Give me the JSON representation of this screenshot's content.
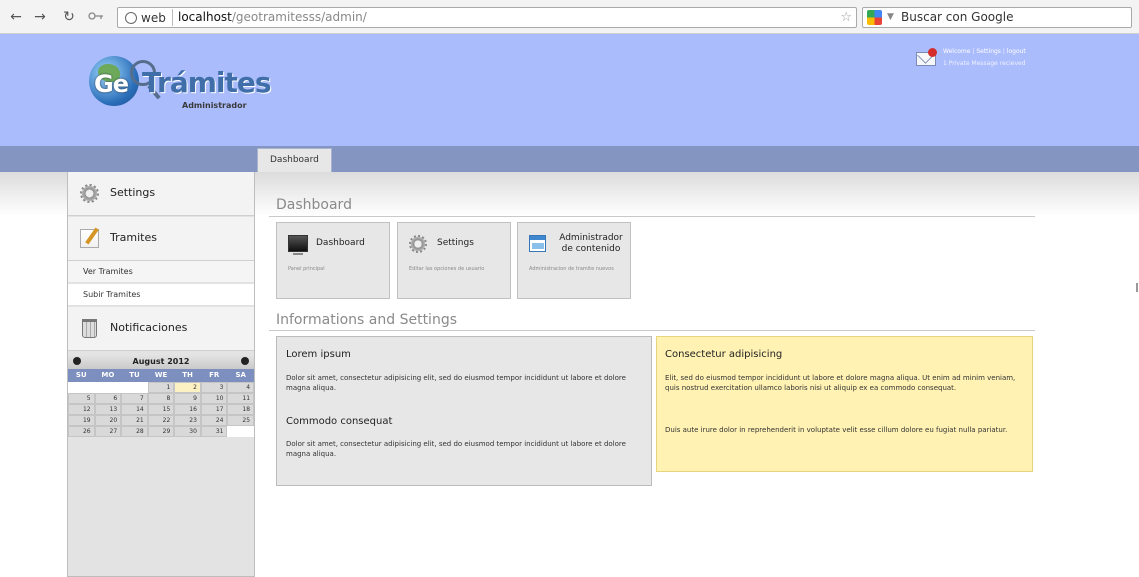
{
  "browser": {
    "back": "←",
    "forward": "→",
    "reload": "↻",
    "site_chip": "web",
    "url_host": "localhost",
    "url_path": "/geotramitesss/admin/",
    "star": "☆",
    "search_placeholder": "Buscar con Google",
    "search_dropdown": "▼"
  },
  "header": {
    "logo_ge": "Ge",
    "logo_tramites": "Trámites",
    "logo_sub": "Administrador",
    "welcome": "Welcome",
    "settings_link": "Settings",
    "logout_link": "logout",
    "separator": "|",
    "message": "1 Private Message recieved"
  },
  "tabs": [
    {
      "label": "Dashboard"
    }
  ],
  "sidebar": {
    "settings": "Settings",
    "tramites": "Tramites",
    "ver_tramites": "Ver Tramites",
    "subir_tramites": "Subir Tramites",
    "notificaciones": "Notificaciones"
  },
  "calendar": {
    "month": "August 2012",
    "days": [
      "SU",
      "MO",
      "TU",
      "WE",
      "TH",
      "FR",
      "SA"
    ],
    "weeks": [
      [
        "",
        "",
        "",
        "1",
        "2",
        "3",
        "4"
      ],
      [
        "5",
        "6",
        "7",
        "8",
        "9",
        "10",
        "11"
      ],
      [
        "12",
        "13",
        "14",
        "15",
        "16",
        "17",
        "18"
      ],
      [
        "19",
        "20",
        "21",
        "22",
        "23",
        "24",
        "25"
      ],
      [
        "26",
        "27",
        "28",
        "29",
        "30",
        "31",
        ""
      ]
    ],
    "today": "2"
  },
  "main": {
    "dashboard_title": "Dashboard",
    "info_title": "Informations and Settings",
    "tiles": [
      {
        "title": "Dashboard",
        "desc": "Panel principal",
        "icon": "monitor-icon"
      },
      {
        "title": "Settings",
        "desc": "Editar las opciones de usuario",
        "icon": "gear-icon"
      },
      {
        "title": "Administrador de contenido",
        "desc": "Administracion de tramite nuevos",
        "icon": "window-icon"
      }
    ],
    "panel_left": {
      "h1": "Lorem ipsum",
      "p1": "Dolor sit amet, consectetur adipisicing elit, sed do eiusmod tempor incididunt ut labore et dolore magna aliqua.",
      "h2": "Commodo consequat",
      "p2": "Dolor sit amet, consectetur adipisicing elit, sed do eiusmod tempor incididunt ut labore et dolore magna aliqua."
    },
    "panel_right": {
      "h1": "Consectetur adipisicing",
      "p1": "Elit, sed do eiusmod tempor incididunt ut labore et dolore magna aliqua. Ut enim ad minim veniam, quis nostrud exercitation ullamco laboris nisi ut aliquip ex ea commodo consequat.",
      "p2": "Duis aute irure dolor in reprehenderit in voluptate velit esse cillum dolore eu fugiat nulla pariatur."
    }
  }
}
